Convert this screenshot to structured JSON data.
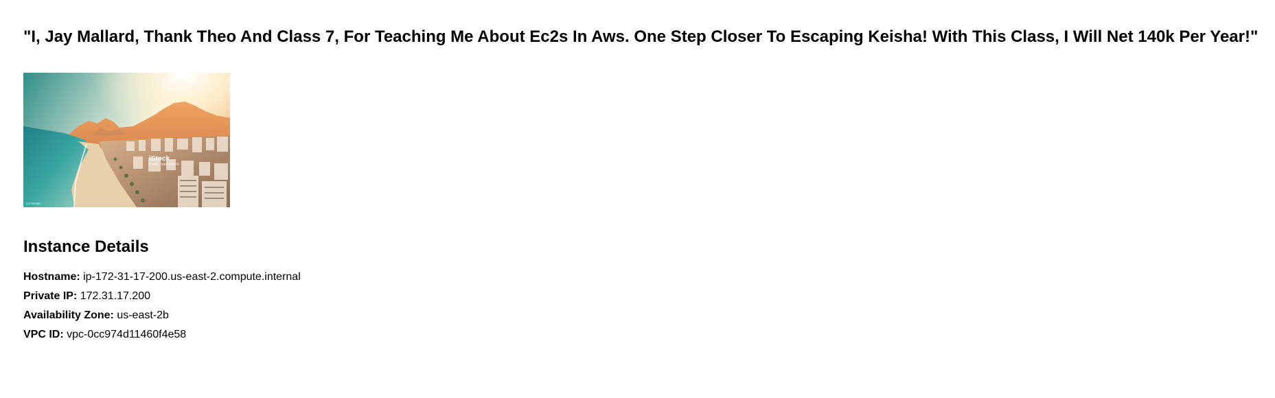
{
  "headline": "\"I, Jay Mallard, Thank Theo And Class 7, For Teaching Me About Ec2s In Aws. One Step Closer To Escaping Keisha! With This Class, I Will Net 140k Per Year!\"",
  "image": {
    "watermark_brand": "iStock",
    "watermark_credit": "Credit: marchello74",
    "corner_id": "1022990850"
  },
  "instance_details": {
    "title": "Instance Details",
    "rows": [
      {
        "label": "Hostname:",
        "value": "ip-172-31-17-200.us-east-2.compute.internal"
      },
      {
        "label": "Private IP:",
        "value": "172.31.17.200"
      },
      {
        "label": "Availability Zone:",
        "value": "us-east-2b"
      },
      {
        "label": "VPC ID:",
        "value": "vpc-0cc974d11460f4e58"
      }
    ]
  }
}
